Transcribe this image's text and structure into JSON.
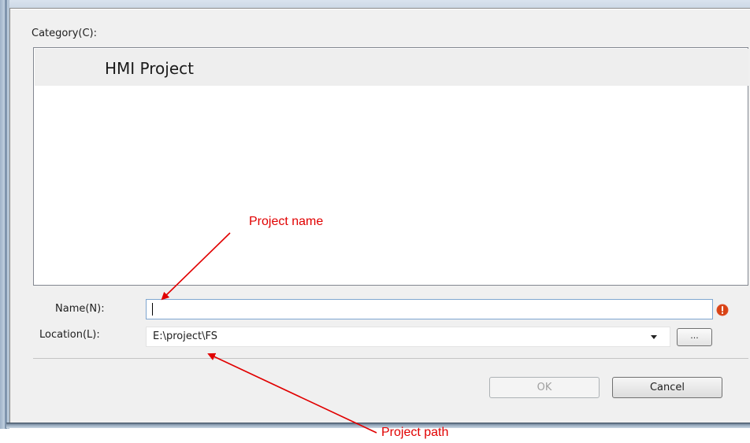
{
  "dialog": {
    "category_label": "Category(C):",
    "categories": [
      {
        "label": "HMI Project",
        "selected": true
      }
    ],
    "name_label": "Name(N):",
    "name_value": "",
    "location_label": "Location(L):",
    "location_value": "E:\\project\\FS",
    "browse_label": "...",
    "ok_label": "OK",
    "cancel_label": "Cancel",
    "name_error_icon": "error-icon"
  },
  "annotations": {
    "project_name": "Project name",
    "project_path": "Project path",
    "color": "#e10000"
  }
}
